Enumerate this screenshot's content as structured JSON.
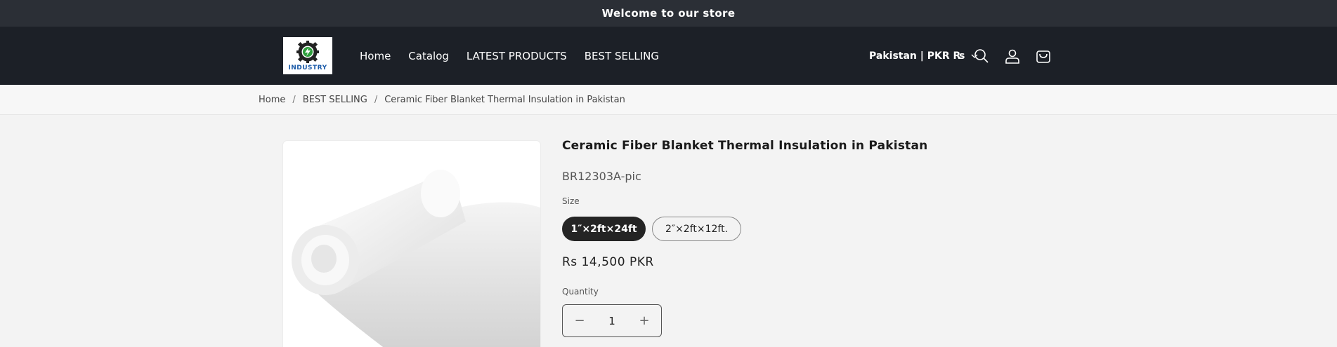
{
  "announcement": "Welcome to our store",
  "logo": {
    "text": "INDUSTRY"
  },
  "nav": [
    "Home",
    "Catalog",
    "LATEST PRODUCTS",
    "BEST SELLING"
  ],
  "country_selector": "Pakistan | PKR ₨",
  "breadcrumb": [
    "Home",
    "BEST SELLING",
    "Ceramic Fiber Blanket Thermal Insulation in Pakistan"
  ],
  "product": {
    "title": "Ceramic Fiber Blanket Thermal Insulation in Pakistan",
    "sku": "BR12303A-pic",
    "size_label": "Size",
    "sizes": [
      {
        "label": "1″×2ft×24ft",
        "selected": true
      },
      {
        "label": "2″×2ft×12ft.",
        "selected": false
      }
    ],
    "price": "Rs 14,500 PKR",
    "quantity_label": "Quantity",
    "quantity": "1",
    "minus": "−",
    "plus": "+"
  },
  "colors": {
    "announcement_bg": "#2b2f36",
    "header_bg": "#1c2027",
    "page_bg": "#f3f3f3",
    "selected_pill": "#242424"
  }
}
